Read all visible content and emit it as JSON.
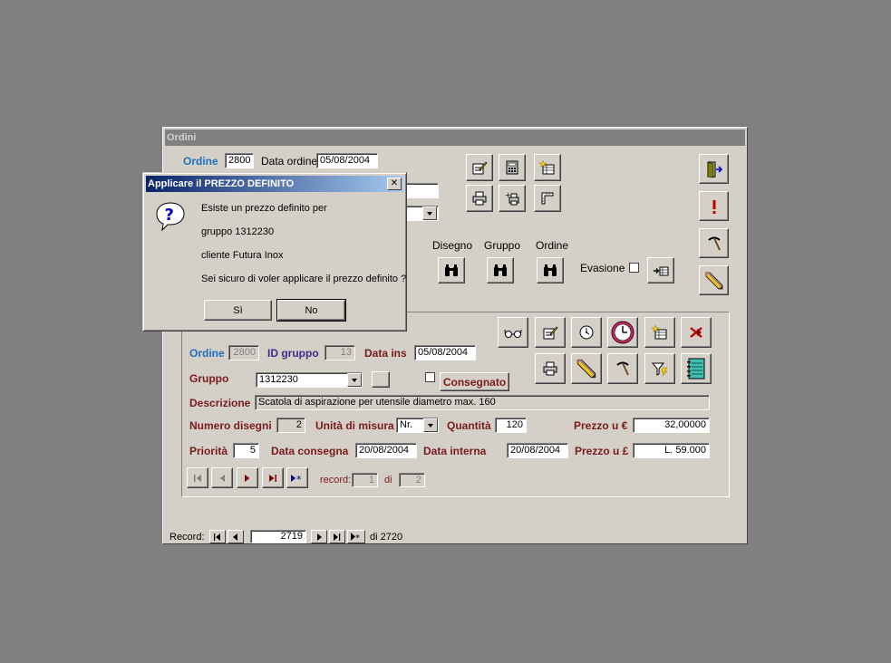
{
  "window": {
    "title": "Ordini",
    "header": {
      "ordine_label": "Ordine",
      "ordine_value": "2800",
      "data_ordine_label": "Data ordine",
      "data_ordine_value": "05/08/2004"
    },
    "search_labels": {
      "disegno": "Disegno",
      "gruppo": "Gruppo",
      "ordine": "Ordine"
    },
    "evasione_label": "Evasione",
    "sub": {
      "ordine_label": "Ordine",
      "ordine_value": "2800",
      "id_gruppo_label": "ID gruppo",
      "id_gruppo_value": "13",
      "data_ins_label": "Data ins",
      "data_ins_value": "05/08/2004",
      "gruppo_label": "Gruppo",
      "gruppo_value": "1312230",
      "consegnato_label": "Consegnato",
      "descrizione_label": "Descrizione",
      "descrizione_value": "Scatola di aspirazione per utensile diametro max. 160",
      "numero_disegni_label": "Numero disegni",
      "numero_disegni_value": "2",
      "unita_label": "Unità di misura",
      "unita_value": "Nr.",
      "quantita_label": "Quantità",
      "quantita_value": "120",
      "prezzo_euro_label": "Prezzo u €",
      "prezzo_euro_value": "32,00000",
      "priorita_label": "Priorità",
      "priorita_value": "5",
      "data_consegna_label": "Data consegna",
      "data_consegna_value": "20/08/2004",
      "data_interna_label": "Data interna",
      "data_interna_value": "20/08/2004",
      "prezzo_lire_label": "Prezzo u £",
      "prezzo_lire_value": "L. 59.000",
      "record_label": "record:",
      "record_value": "1",
      "di_label": "di",
      "di_value": "2"
    },
    "footer": {
      "record_label": "Record:",
      "record_value": "2719",
      "total": "di 2720"
    }
  },
  "dialog": {
    "title": "Applicare il PREZZO DEFINITO",
    "line1": "Esiste un prezzo definito per",
    "line2": "gruppo 1312230",
    "line3": "cliente Futura Inox",
    "line4": "Sei sicuro di voler applicare il prezzo definito ?",
    "yes_label": "Sì",
    "no_label": "No",
    "close_glyph": "✕",
    "icon": "question-icon"
  },
  "colors": {
    "desktop": "#808080",
    "face": "#d4d0c8",
    "label_blue": "#1f6fbf",
    "label_purple": "#3b2c8f",
    "label_maroon": "#7a1a1a",
    "title_active": "#0a246a"
  }
}
